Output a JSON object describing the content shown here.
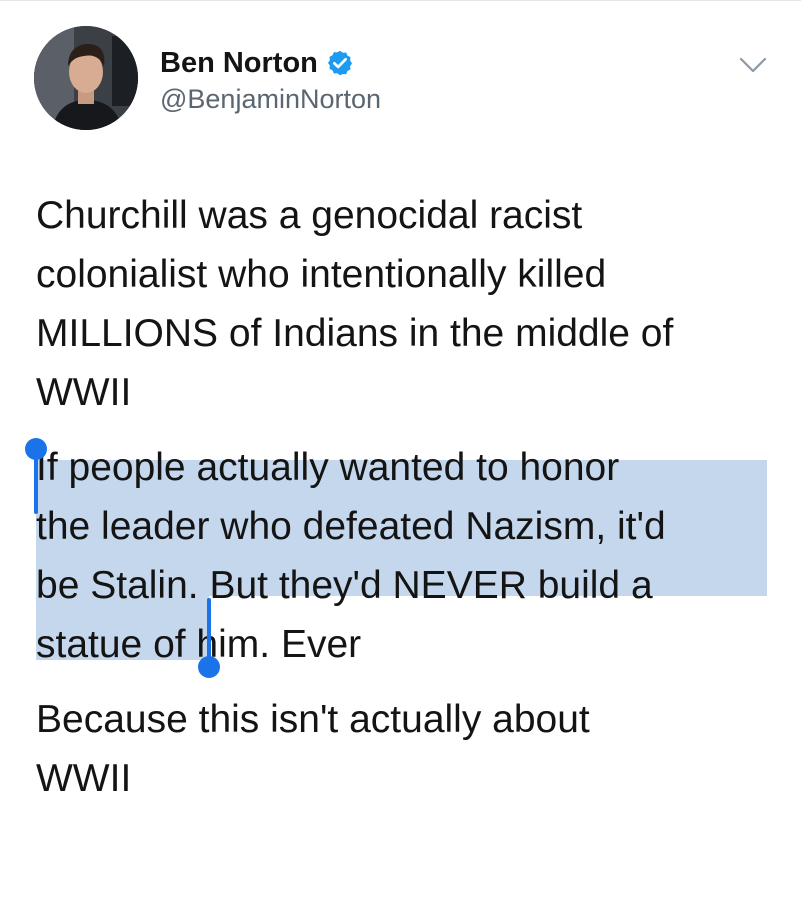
{
  "author": {
    "name": "Ben Norton",
    "handle": "@BenjaminNorton",
    "verified_icon": "verified-badge-icon",
    "avatar": "profile-photo"
  },
  "menu_icon": "chevron-down-icon",
  "tweet": {
    "lines": [
      "Churchill was a genocidal racist",
      "colonialist who intentionally killed",
      "MILLIONS of Indians in the middle of",
      "WWII",
      "If people actually wanted to honor",
      "the leader who defeated Nazism, it'd",
      "be Stalin",
      ". But they'd NEVER build a",
      "statue of him. Ever",
      "Because this isn't actually about",
      "WWII"
    ]
  },
  "colors": {
    "text": "#141414",
    "handle": "#5b6670",
    "selection": "#c5d7ec",
    "selection_handle": "#1a73e8",
    "verified": "#1d9bf0"
  }
}
